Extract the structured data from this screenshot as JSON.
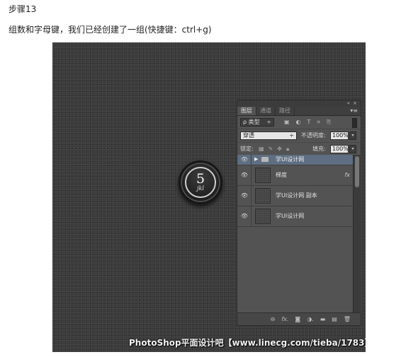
{
  "step_title": "步骤13",
  "step_description": "组数和字母键，我们已经创建了一组(快捷键：ctrl+g)",
  "key_button": {
    "digit": "5",
    "letters": "jkl"
  },
  "panel": {
    "top_controls": "«  ×",
    "tabs": [
      "图层",
      "通道",
      "路径"
    ],
    "menu_icon": "▾≡",
    "filter": {
      "label": "ρ 类型",
      "arrow": "÷",
      "icons": [
        "image-filter-icon",
        "adjustment-filter-icon",
        "type-filter-icon",
        "shape-filter-icon",
        "smart-object-filter-icon"
      ]
    },
    "blend_mode": "穿透",
    "blend_arrow": "÷",
    "opacity_label": "不透明度:",
    "opacity_value": "100%",
    "lock_label": "锁定:",
    "fill_label": "填充:",
    "fill_value": "100%",
    "layers": [
      {
        "name": "学UI设计网",
        "type": "group",
        "selected": true
      },
      {
        "name": "梯度",
        "type": "layer",
        "fx": "fx"
      },
      {
        "name": "学UI设计网 副本",
        "type": "layer"
      },
      {
        "name": "学UI设计网",
        "type": "layer"
      }
    ],
    "bottom_icons": [
      "link-layers-icon",
      "fx-icon",
      "add-mask-icon",
      "adjustment-layer-icon",
      "new-group-icon",
      "new-layer-icon",
      "delete-layer-icon"
    ]
  },
  "watermark": "PhotoShop平面设计吧【www.linecg.com/tieba/1783】"
}
